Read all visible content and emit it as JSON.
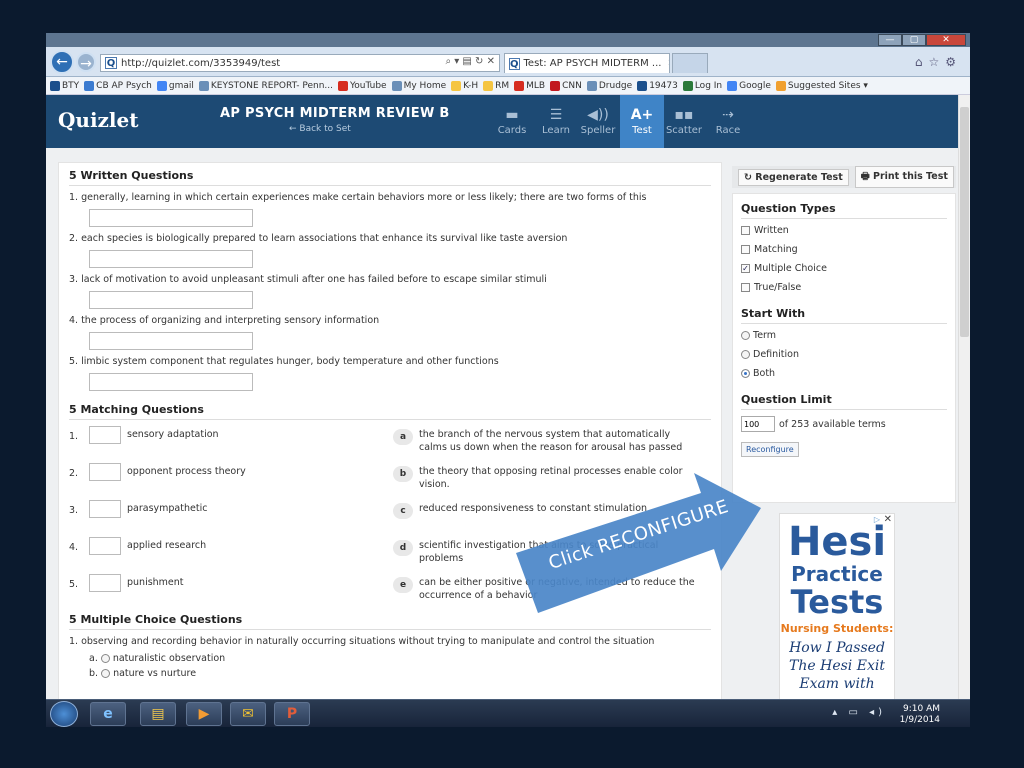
{
  "browser": {
    "url": "http://quizlet.com/3353949/test",
    "tab_active": "Test: AP PSYCH MIDTERM ...",
    "window_buttons": [
      "—",
      "▢",
      "✕"
    ],
    "favorites": [
      "BTY",
      "CB AP Psych",
      "gmail",
      "KEYSTONE REPORT- Penn...",
      "YouTube",
      "My Home",
      "K-H",
      "RM",
      "MLB",
      "CNN",
      "Drudge",
      "19473",
      "Log In",
      "Google",
      "Suggested Sites ▾"
    ]
  },
  "header": {
    "logo": "Quizlet",
    "set_title": "AP PSYCH MIDTERM REVIEW B",
    "back_link": "← Back to Set",
    "modes": [
      {
        "label": "Cards",
        "icon": "▬"
      },
      {
        "label": "Learn",
        "icon": "☰"
      },
      {
        "label": "Speller",
        "icon": "◀))"
      },
      {
        "label": "Test",
        "icon": "A+"
      },
      {
        "label": "Scatter",
        "icon": "▪▪"
      },
      {
        "label": "Race",
        "icon": "⇢"
      }
    ]
  },
  "written": {
    "heading": "5 Written Questions",
    "questions": [
      "1.  generally, learning in which certain experiences make certain behaviors more or less likely; there are two forms of this",
      "2.  each species is biologically prepared to learn associations that enhance its survival like taste aversion",
      "3.  lack of motivation to avoid unpleasant stimuli after one has failed before to escape similar stimuli",
      "4.  the process of organizing and interpreting sensory information",
      "5.  limbic system component that regulates hunger, body temperature and other functions"
    ]
  },
  "matching": {
    "heading": "5 Matching Questions",
    "rows": [
      {
        "num": "1.",
        "term": "sensory adaptation",
        "letter": "a",
        "def": "the branch of the nervous system that automatically calms us down when the reason for arousal has passed"
      },
      {
        "num": "2.",
        "term": "opponent process theory",
        "letter": "b",
        "def": "the theory that opposing retinal processes enable color vision."
      },
      {
        "num": "3.",
        "term": "parasympathetic",
        "letter": "c",
        "def": "reduced responsiveness to constant stimulation"
      },
      {
        "num": "4.",
        "term": "applied research",
        "letter": "d",
        "def": "scientific investigation that aims to solve practical problems"
      },
      {
        "num": "5.",
        "term": "punishment",
        "letter": "e",
        "def": "can be either positive or negative, intended to reduce the occurrence of a behavior"
      }
    ]
  },
  "mc": {
    "heading": "5 Multiple Choice Questions",
    "q1": "1.  observing and recording behavior in naturally occurring situations without trying to manipulate and control the situation",
    "opt_a": "naturalistic observation",
    "opt_b": "nature vs nurture",
    "opt_a_letter": "a.",
    "opt_b_letter": "b."
  },
  "sidebar": {
    "regenerate": "Regenerate Test",
    "print": "Print this Test",
    "question_types_heading": "Question Types",
    "types": [
      {
        "label": "Written",
        "checked": false
      },
      {
        "label": "Matching",
        "checked": false
      },
      {
        "label": "Multiple Choice",
        "checked": true
      },
      {
        "label": "True/False",
        "checked": false
      }
    ],
    "start_with_heading": "Start With",
    "start_options": [
      {
        "label": "Term",
        "selected": false
      },
      {
        "label": "Definition",
        "selected": false
      },
      {
        "label": "Both",
        "selected": true
      }
    ],
    "limit_heading": "Question Limit",
    "limit_value": "100",
    "limit_suffix": "of 253 available terms",
    "reconfigure": "Reconfigure"
  },
  "ad": {
    "line1": "Hesi",
    "line2": "Practice",
    "line3": "Tests",
    "line4": "Nursing Students:",
    "line5": "How I Passed",
    "line6": "The Hesi Exit",
    "line7": "Exam with"
  },
  "callout": {
    "text": "Click RECONFIGURE",
    "color": "#4a86c8"
  },
  "taskbar": {
    "time": "9:10 AM",
    "date": "1/9/2014"
  }
}
